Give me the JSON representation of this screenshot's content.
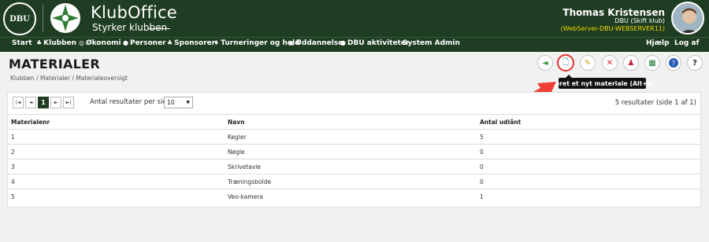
{
  "header": {
    "logo_text": "DBU",
    "brand_title": "KlubOffice",
    "brand_subtitle": "Styrker klubben",
    "user_name": "Thomas Kristensen",
    "user_club": "DBU (Skift klub)",
    "user_server": "(WebServer-DBU-WEBSERVER11)"
  },
  "nav": {
    "items": [
      {
        "label": "Start",
        "icon": ""
      },
      {
        "label": "Klubben",
        "icon": "♣"
      },
      {
        "label": "Økonomi",
        "icon": "◎"
      },
      {
        "label": "Personer",
        "icon": "●"
      },
      {
        "label": "Sponsorer",
        "icon": "♣"
      },
      {
        "label": "Turneringer og hold",
        "icon": "♦"
      },
      {
        "label": "Uddannelse",
        "icon": "▣"
      },
      {
        "label": "DBU aktiviteter",
        "icon": "●"
      },
      {
        "label": "System Admin",
        "icon": ""
      }
    ],
    "help": "Hjælp",
    "logout": "Log af"
  },
  "page": {
    "title": "MATERIALER",
    "breadcrumb": "Klubben / Materialer / Materialeoversigt"
  },
  "toolbar": {
    "buttons": [
      {
        "icon": "back-arrow-icon",
        "glyph": "◄",
        "color": "#3a9a3a"
      },
      {
        "icon": "new-document-icon",
        "glyph": "🗋",
        "color": "#3a6fb0"
      },
      {
        "icon": "edit-icon",
        "glyph": "✎",
        "color": "#d4a017"
      },
      {
        "icon": "delete-icon",
        "glyph": "✕",
        "color": "#d22"
      },
      {
        "icon": "user-icon",
        "glyph": "♟",
        "color": "#b23"
      },
      {
        "icon": "excel-icon",
        "glyph": "▦",
        "color": "#1c7a34"
      },
      {
        "icon": "info-icon",
        "glyph": "?",
        "color": "#2a5cb8"
      },
      {
        "icon": "help-icon",
        "glyph": "?",
        "color": "#222"
      }
    ],
    "tooltip": "Opret et nyt materiale (Alt+n)"
  },
  "pager": {
    "first": "|◄",
    "prev": "◄",
    "current": "1",
    "next": "►",
    "last": "►|",
    "per_page_label": "Antal resultater per side",
    "per_page_value": "10",
    "result_count": "5 resultater (side 1 af 1)"
  },
  "table": {
    "columns": [
      "Materialenr",
      "Navn",
      "Antal udlånt"
    ],
    "rows": [
      [
        "1",
        "Kegler",
        "5"
      ],
      [
        "2",
        "Nøgle",
        "0"
      ],
      [
        "3",
        "Skrivetavle",
        "0"
      ],
      [
        "4",
        "Træningsbolde",
        "0"
      ],
      [
        "5",
        "Veo-kamera",
        "1"
      ]
    ]
  },
  "colors": {
    "header_bg": "#1f3d22",
    "highlight": "#e0332e",
    "server_text": "#f0d800"
  }
}
